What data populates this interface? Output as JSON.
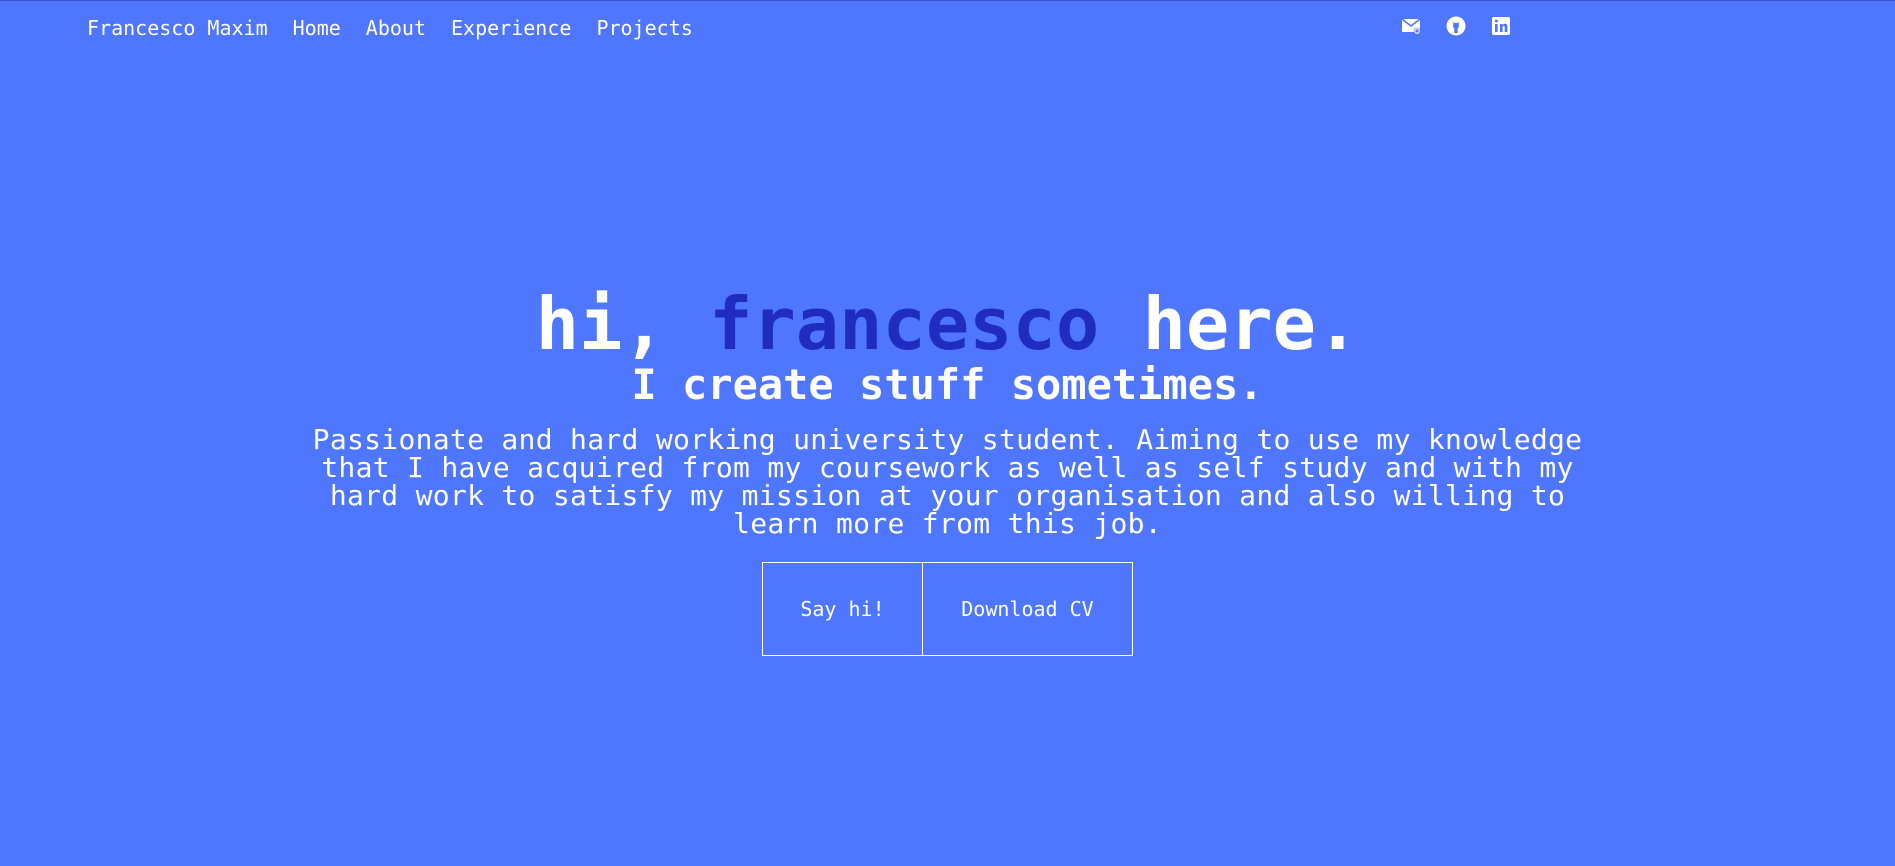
{
  "nav": {
    "brand": "Francesco Maxim",
    "items": [
      {
        "label": "Home"
      },
      {
        "label": "About"
      },
      {
        "label": "Experience"
      },
      {
        "label": "Projects"
      }
    ]
  },
  "social": {
    "icons": [
      "email-icon",
      "github-icon",
      "linkedin-icon"
    ]
  },
  "hero": {
    "title_prefix": "hi, ",
    "title_name": "francesco",
    "title_suffix": " here.",
    "subtitle": "I create stuff sometimes.",
    "description": "Passionate and hard working university student. Aiming to use my knowledge that I have acquired from my coursework as well as self study and with my hard work to satisfy my mission at your organisation and also willing to learn more from this job.",
    "buttons": {
      "say_hi": "Say hi!",
      "download_cv": "Download CV"
    }
  },
  "colors": {
    "background": "#4f76ff",
    "accent": "#1f2bc1",
    "text": "#ffffff"
  }
}
